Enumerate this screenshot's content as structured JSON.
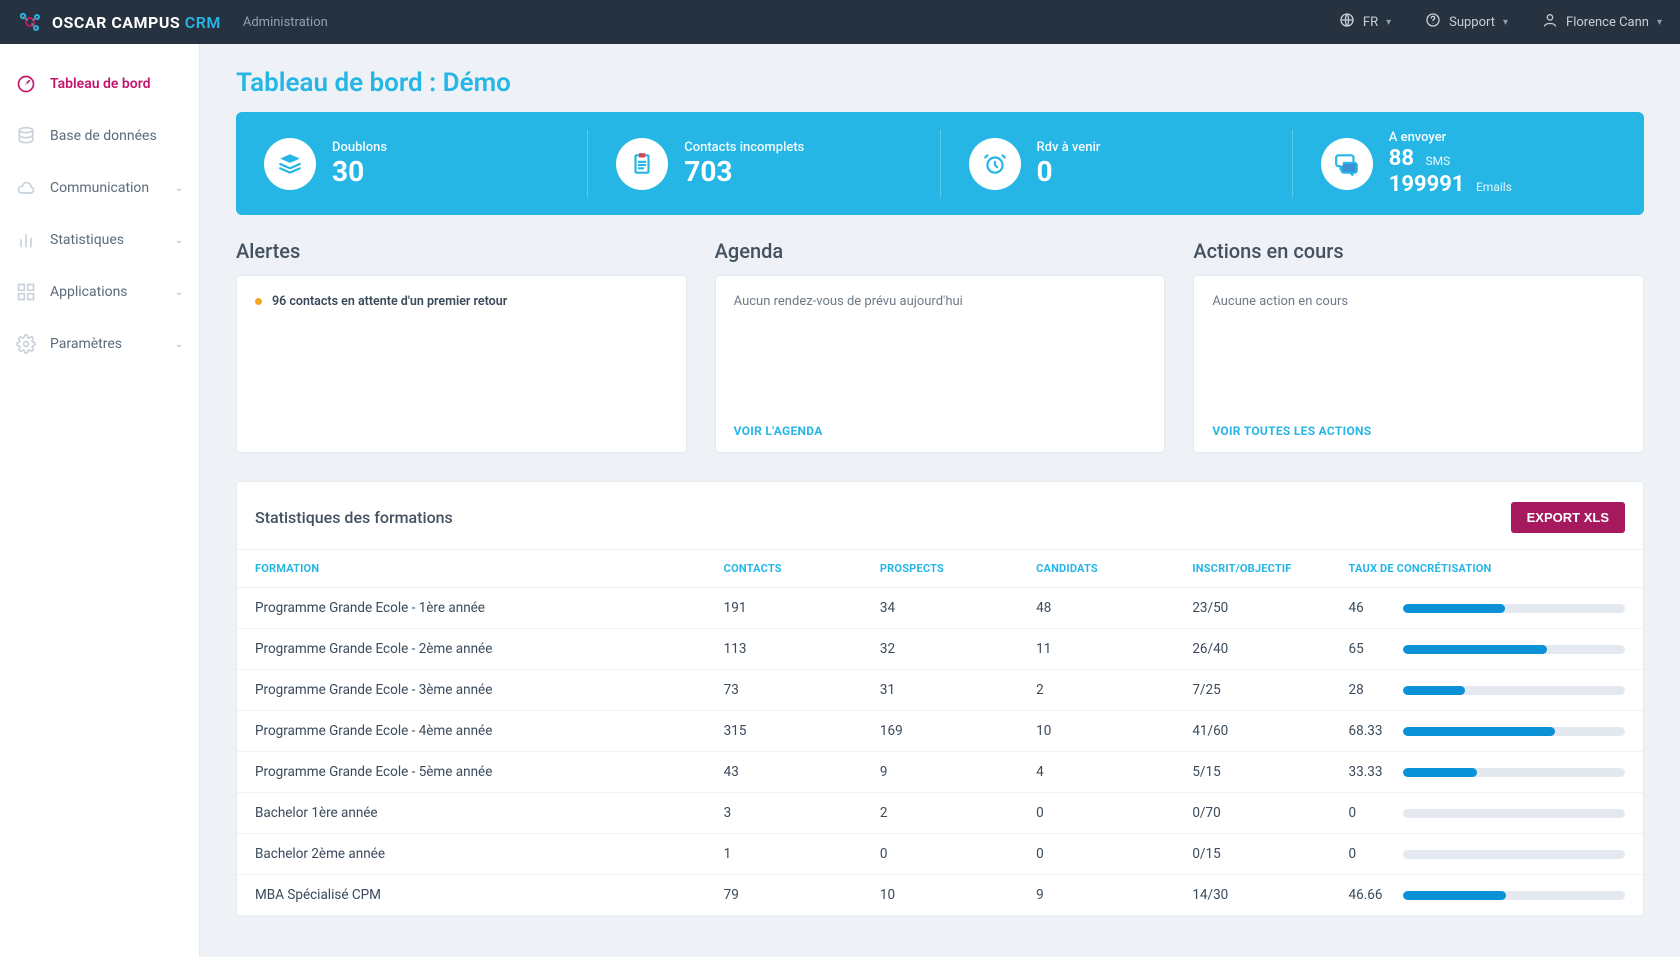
{
  "header": {
    "brand_main": "OSCAR CAMPUS",
    "brand_suffix": "CRM",
    "admin_link": "Administration",
    "lang": "FR",
    "support": "Support",
    "user_name": "Florence Cann"
  },
  "sidebar": {
    "items": [
      {
        "label": "Tableau de bord",
        "icon": "gauge-icon",
        "active": true,
        "expandable": false
      },
      {
        "label": "Base de données",
        "icon": "database-icon",
        "active": false,
        "expandable": false
      },
      {
        "label": "Communication",
        "icon": "cloud-icon",
        "active": false,
        "expandable": true
      },
      {
        "label": "Statistiques",
        "icon": "bar-chart-icon",
        "active": false,
        "expandable": true
      },
      {
        "label": "Applications",
        "icon": "grid-icon",
        "active": false,
        "expandable": true
      },
      {
        "label": "Paramètres",
        "icon": "settings-icon",
        "active": false,
        "expandable": true
      }
    ]
  },
  "page": {
    "title": "Tableau de bord : Démo"
  },
  "summary": {
    "doublons": {
      "label": "Doublons",
      "value": "30"
    },
    "incomplets": {
      "label": "Contacts incomplets",
      "value": "703"
    },
    "rdv": {
      "label": "Rdv à venir",
      "value": "0"
    },
    "envoi": {
      "label": "A envoyer",
      "sms_value": "88",
      "sms_unit": "SMS",
      "email_value": "199991",
      "email_unit": "Emails"
    }
  },
  "panels": {
    "alerts": {
      "title": "Alertes",
      "line": "96 contacts en attente d'un premier retour"
    },
    "agenda": {
      "title": "Agenda",
      "body": "Aucun rendez-vous de prévu aujourd'hui",
      "link": "VOIR L'AGENDA"
    },
    "actions": {
      "title": "Actions en cours",
      "body": "Aucune action en cours",
      "link": "VOIR TOUTES LES ACTIONS"
    }
  },
  "stats": {
    "title": "Statistiques des formations",
    "export_label": "EXPORT XLS",
    "columns": {
      "formation": "FORMATION",
      "contacts": "CONTACTS",
      "prospects": "PROSPECTS",
      "candidats": "CANDIDATS",
      "inscrit": "INSCRIT/OBJECTIF",
      "taux": "TAUX DE CONCRÉTISATION"
    },
    "rows": [
      {
        "formation": "Programme Grande Ecole - 1ère année",
        "contacts": "191",
        "prospects": "34",
        "candidats": "48",
        "inscrit": "23/50",
        "taux": "46",
        "pct": 46
      },
      {
        "formation": "Programme Grande Ecole - 2ème année",
        "contacts": "113",
        "prospects": "32",
        "candidats": "11",
        "inscrit": "26/40",
        "taux": "65",
        "pct": 65
      },
      {
        "formation": "Programme Grande Ecole - 3ème année",
        "contacts": "73",
        "prospects": "31",
        "candidats": "2",
        "inscrit": "7/25",
        "taux": "28",
        "pct": 28
      },
      {
        "formation": "Programme Grande Ecole - 4ème année",
        "contacts": "315",
        "prospects": "169",
        "candidats": "10",
        "inscrit": "41/60",
        "taux": "68.33",
        "pct": 68.33
      },
      {
        "formation": "Programme Grande Ecole - 5ème année",
        "contacts": "43",
        "prospects": "9",
        "candidats": "4",
        "inscrit": "5/15",
        "taux": "33.33",
        "pct": 33.33
      },
      {
        "formation": "Bachelor 1ère année",
        "contacts": "3",
        "prospects": "2",
        "candidats": "0",
        "inscrit": "0/70",
        "taux": "0",
        "pct": 0
      },
      {
        "formation": "Bachelor 2ème année",
        "contacts": "1",
        "prospects": "0",
        "candidats": "0",
        "inscrit": "0/15",
        "taux": "0",
        "pct": 0
      },
      {
        "formation": "MBA Spécialisé CPM",
        "contacts": "79",
        "prospects": "10",
        "candidats": "9",
        "inscrit": "14/30",
        "taux": "46.66",
        "pct": 46.66
      }
    ]
  }
}
